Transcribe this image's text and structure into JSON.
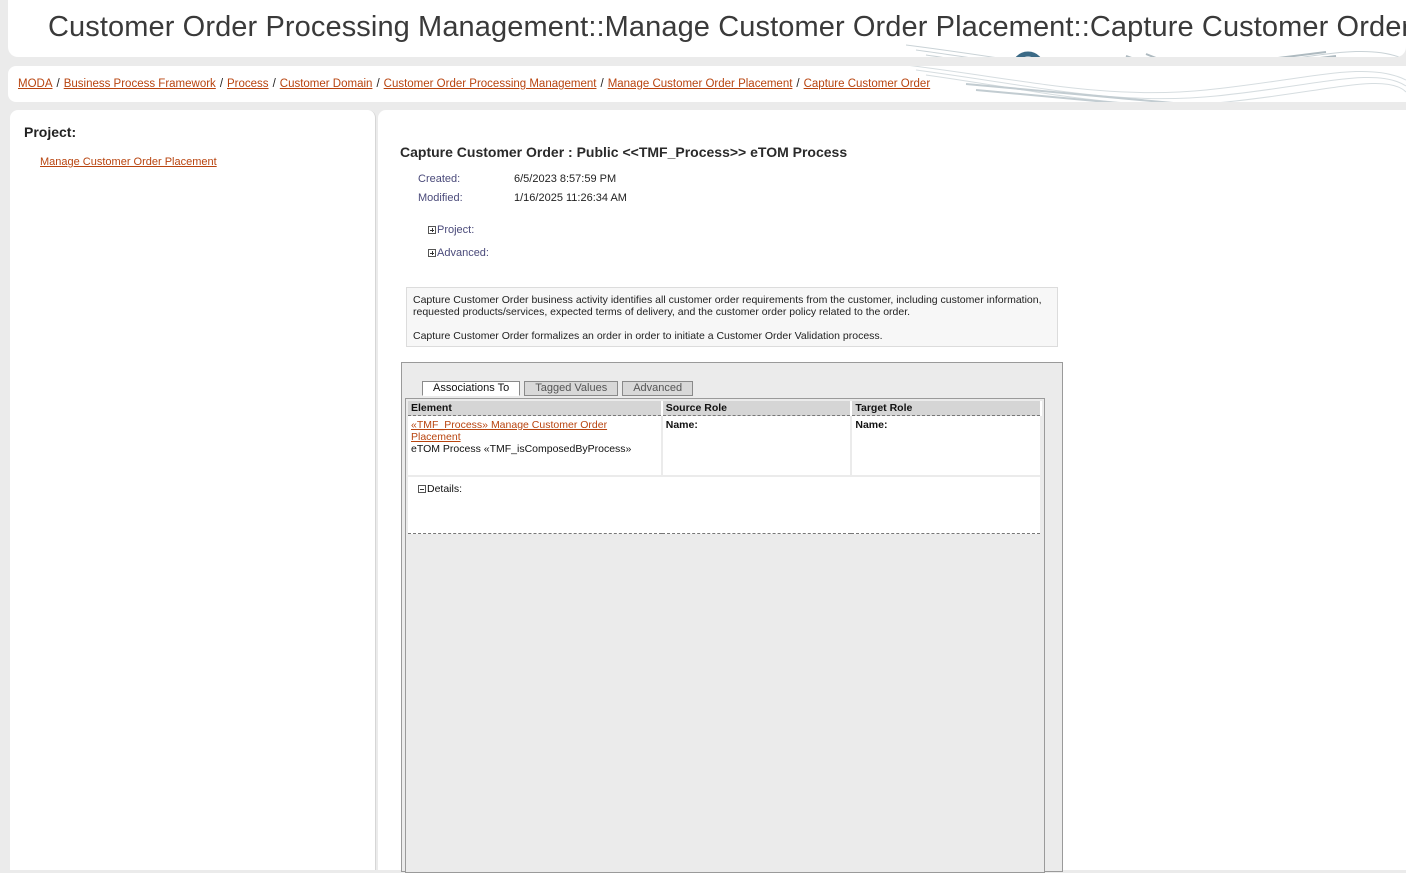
{
  "header": {
    "title": "Customer Order Processing Management::Manage Customer Order Placement::Capture Customer Order"
  },
  "breadcrumb": [
    {
      "label": "MODA"
    },
    {
      "label": "Business Process Framework"
    },
    {
      "label": "Process"
    },
    {
      "label": "Customer Domain"
    },
    {
      "label": "Customer Order Processing Management"
    },
    {
      "label": "Manage Customer Order Placement"
    },
    {
      "label": "Capture Customer Order"
    }
  ],
  "sidebar": {
    "heading": "Project:",
    "link": "Manage Customer Order Placement"
  },
  "element": {
    "heading": "Capture Customer Order : Public <<TMF_Process>> eTOM Process",
    "created_label": "Created:",
    "created_value": "6/5/2023 8:57:59 PM",
    "modified_label": "Modified:",
    "modified_value": "1/16/2025 11:26:34 AM",
    "project_expander": "Project:",
    "advanced_expander": "Advanced:",
    "notes": [
      "Capture Customer Order business activity identifies all customer order requirements from the customer, including customer information, requested products/services, expected terms of delivery, and the customer order policy related to the order.",
      "Capture Customer Order formalizes an order in order to initiate a Customer Order Validation process."
    ]
  },
  "tabs": [
    {
      "label": "Associations To",
      "active": true
    },
    {
      "label": "Tagged Values",
      "active": false
    },
    {
      "label": "Advanced",
      "active": false
    }
  ],
  "associations": {
    "columns": [
      "Element",
      "Source Role",
      "Target Role"
    ],
    "rows": [
      {
        "element_link": "«TMF_Process» Manage Customer Order Placement",
        "element_type": "eTOM Process «TMF_isComposedByProcess»",
        "source_role": "Name:",
        "target_role": "Name:"
      }
    ],
    "details_label": "Details:"
  }
}
